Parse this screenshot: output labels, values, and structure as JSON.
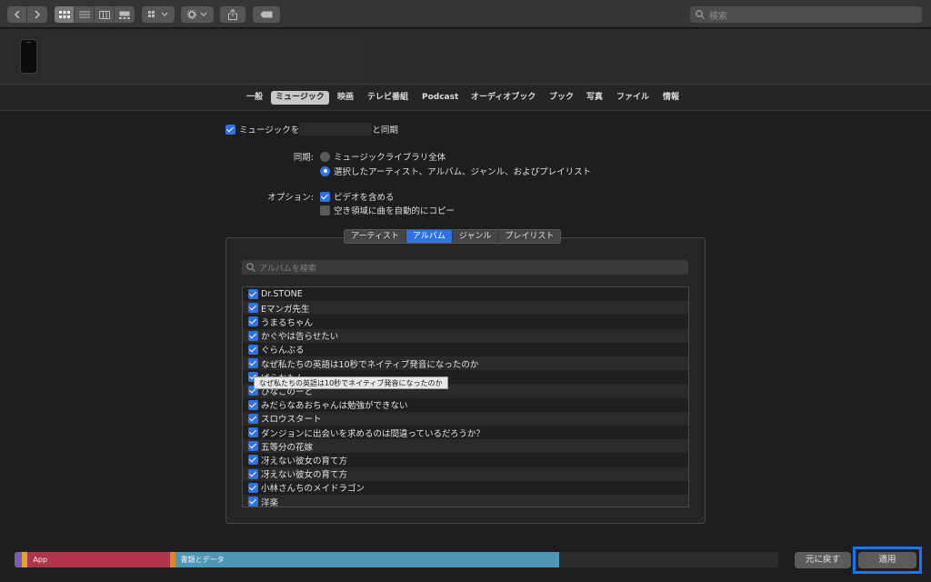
{
  "toolbar": {
    "search_placeholder": "検索",
    "icons": [
      "back-icon",
      "forward-icon",
      "grid-view-icon",
      "list-view-icon",
      "column-view-icon",
      "gallery-view-icon",
      "group-icon",
      "gear-icon",
      "share-icon",
      "tag-icon",
      "search-icon"
    ]
  },
  "tabs": [
    {
      "label": "一般",
      "active": false
    },
    {
      "label": "ミュージック",
      "active": true
    },
    {
      "label": "映画",
      "active": false
    },
    {
      "label": "テレビ番組",
      "active": false
    },
    {
      "label": "Podcast",
      "active": false
    },
    {
      "label": "オーディオブック",
      "active": false
    },
    {
      "label": "ブック",
      "active": false
    },
    {
      "label": "写真",
      "active": false
    },
    {
      "label": "ファイル",
      "active": false
    },
    {
      "label": "情報",
      "active": false
    }
  ],
  "sync": {
    "label_prefix": "ミュージックを",
    "label_suffix": "と同期",
    "checked": true,
    "sync_label": "同期:",
    "options": [
      {
        "label": "ミュージックライブラリ全体",
        "selected": false
      },
      {
        "label": "選択したアーティスト、アルバム、ジャンル、およびプレイリスト",
        "selected": true
      }
    ],
    "options_label": "オプション:",
    "include_video": {
      "label": "ビデオを含める",
      "checked": true
    },
    "autofill": {
      "label": "空き領域に曲を自動的にコピー",
      "checked": false
    }
  },
  "browser": {
    "segments": [
      {
        "label": "アーティスト",
        "active": false
      },
      {
        "label": "アルバム",
        "active": true
      },
      {
        "label": "ジャンル",
        "active": false
      },
      {
        "label": "プレイリスト",
        "active": false
      }
    ],
    "search_placeholder": "アルバムを検索",
    "albums": [
      "Dr.STONE",
      "Eマンガ先生",
      "うまるちゃん",
      "かぐやは告らせたい",
      "ぐらんぶる",
      "なぜ私たちの英語は10秒でネイティブ発音になったのか",
      "ばらかもん",
      "ひなこのーと",
      "みだらなあおちゃんは勉強ができない",
      "スロウスタート",
      "ダンジョンに出会いを求めるのは間違っているだろうか？",
      "五等分の花嫁",
      "冴えない彼女の育て方",
      "冴えない彼女の育て方",
      "小林さんちのメイドラゴン",
      "洋楽"
    ],
    "tooltip": "なぜ私たちの英語は10秒でネイティブ発音になったのか"
  },
  "storage": {
    "segments": [
      {
        "label": "",
        "color": "#7d5fa8",
        "fraction": 0.01
      },
      {
        "label": "",
        "color": "#d7a43a",
        "fraction": 0.002
      },
      {
        "label": "App",
        "color": "#b1354a",
        "fraction": 0.186
      },
      {
        "label": "",
        "color": "#d98a2b",
        "fraction": 0.004
      },
      {
        "label": "書類とデータ",
        "color": "#4f98b5",
        "fraction": 0.503
      }
    ]
  },
  "buttons": {
    "revert": "元に戻す",
    "apply": "適用"
  }
}
